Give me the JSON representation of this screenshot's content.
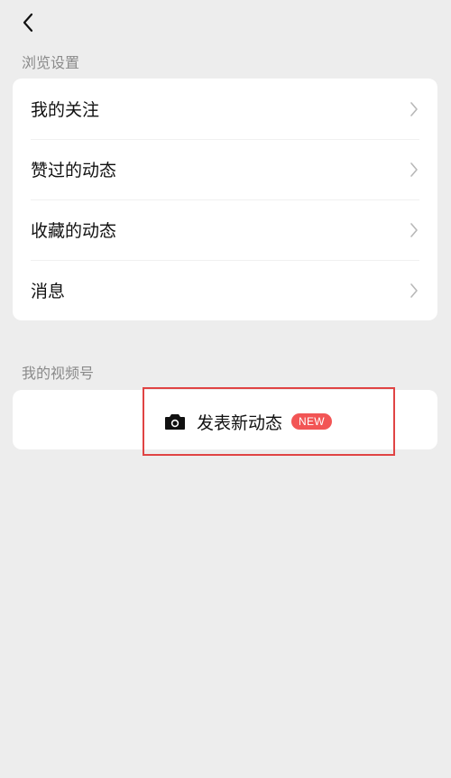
{
  "header": {
    "back_icon": "chevron-left-icon"
  },
  "browse_settings": {
    "title": "浏览设置",
    "items": [
      {
        "label": "我的关注"
      },
      {
        "label": "赞过的动态"
      },
      {
        "label": "收藏的动态"
      },
      {
        "label": "消息"
      }
    ]
  },
  "my_channel": {
    "title": "我的视频号",
    "publish_label": "发表新动态",
    "badge": "NEW",
    "icon": "camera-icon"
  },
  "colors": {
    "background": "#ededed",
    "card": "#ffffff",
    "badge": "#f25555",
    "highlight": "#e04444"
  }
}
